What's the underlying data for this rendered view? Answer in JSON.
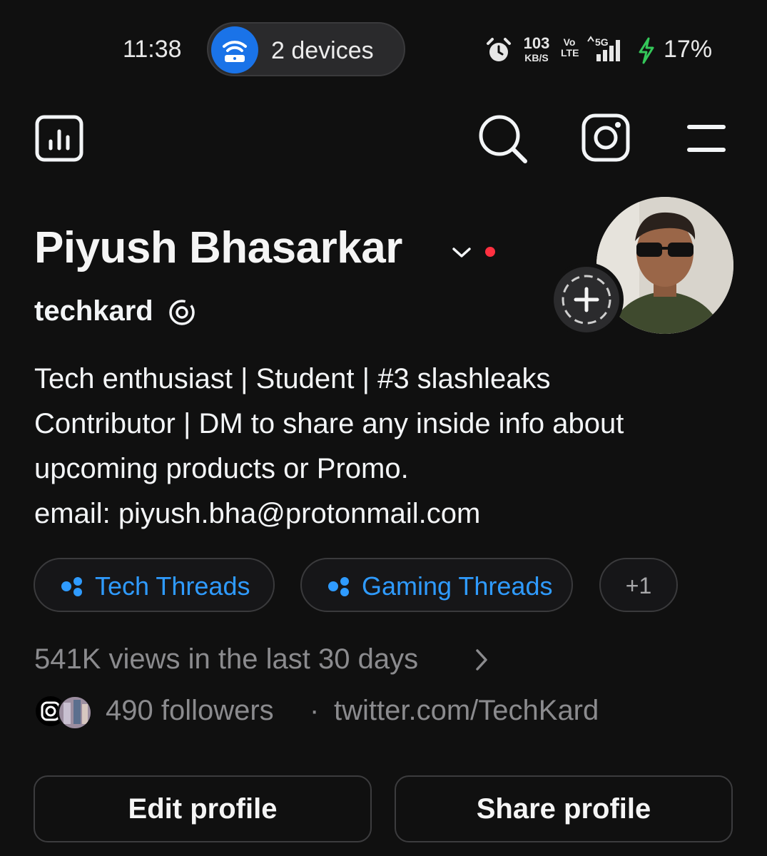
{
  "status_bar": {
    "time": "11:38",
    "hotspot_label": "2 devices",
    "net_speed_value": "103",
    "net_speed_unit": "KB/S",
    "volte_top": "Vo",
    "volte_bottom": "LTE",
    "network_type": "5G",
    "battery": "17%",
    "icons": [
      "hotspot-icon",
      "alarm-icon",
      "signal-icon",
      "charging-bolt-icon"
    ]
  },
  "toolbar": {
    "icons": [
      "insights-icon",
      "search-icon",
      "instagram-icon",
      "menu-icon"
    ]
  },
  "profile": {
    "name": "Piyush Bhasarkar",
    "username": "techkard",
    "bio_lines": [
      "Tech enthusiast | Student | #3 slashleaks",
      "Contributor | DM to share any inside info about",
      "upcoming products or Promo.",
      "email: piyush.bha@protonmail.com"
    ]
  },
  "channels": [
    {
      "label": "Tech Threads"
    },
    {
      "label": "Gaming Threads"
    },
    {
      "label": "+1"
    }
  ],
  "stats": {
    "views": "541K views in the last 30 days",
    "followers": "490 followers",
    "separator": "·",
    "link": "twitter.com/TechKard"
  },
  "actions": {
    "edit_label": "Edit profile",
    "share_label": "Share profile"
  },
  "colors": {
    "background": "#101010",
    "accent_blue": "#2f9bff",
    "hotspot_blue": "#1a73e8",
    "muted_text": "#8b8b8e",
    "notification_red": "#ff3040",
    "charging_green": "#34c759"
  }
}
